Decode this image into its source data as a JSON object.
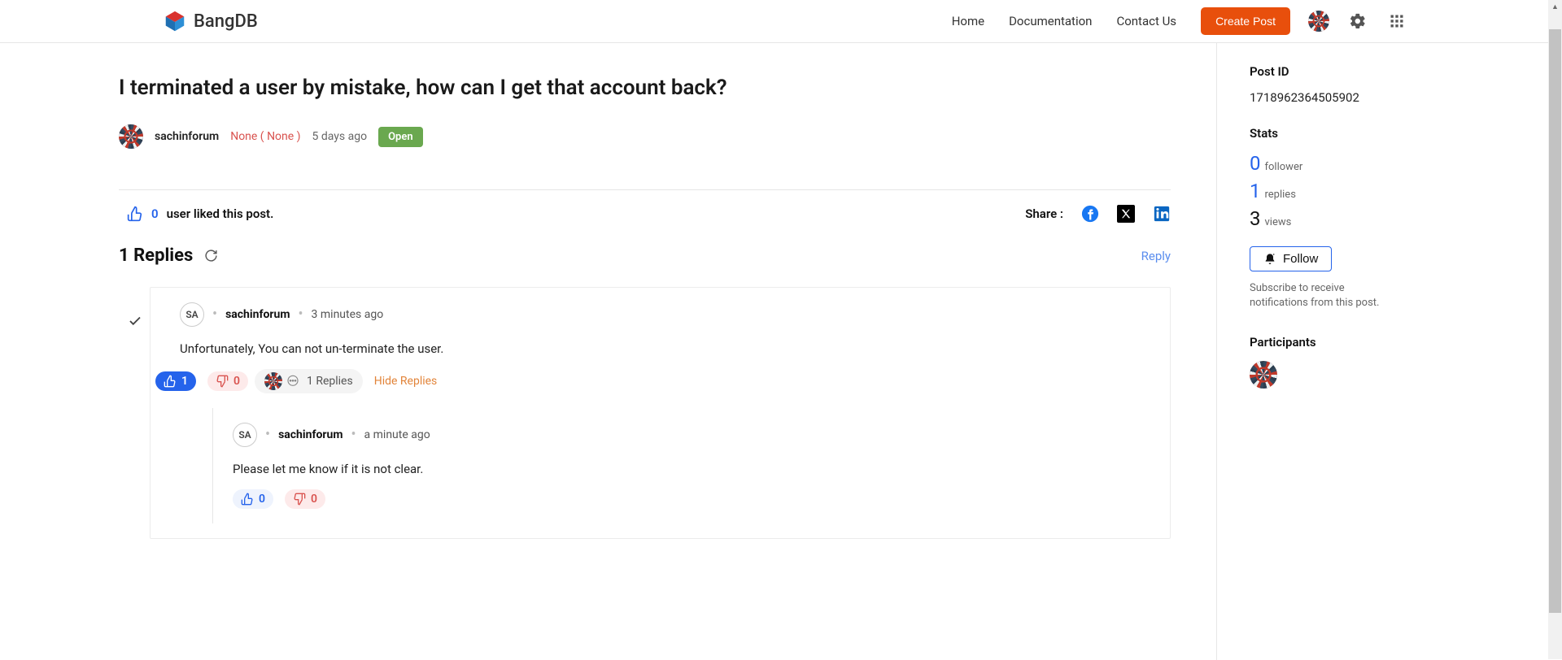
{
  "header": {
    "brand": "BangDB",
    "nav": {
      "home": "Home",
      "docs": "Documentation",
      "contact": "Contact Us"
    },
    "create_post": "Create Post"
  },
  "post": {
    "title": "I terminated a user by mistake, how can I get that account back?",
    "author": "sachinforum",
    "category": "None ( None )",
    "time": "5 days ago",
    "status": "Open"
  },
  "likes": {
    "count": "0",
    "text": "user liked this post."
  },
  "share": {
    "label": "Share :"
  },
  "replies_section": {
    "title": "1 Replies",
    "reply_link": "Reply"
  },
  "reply1": {
    "initials": "SA",
    "author": "sachinforum",
    "time": "3 minutes ago",
    "body": "Unfortunately, You can not un-terminate the user.",
    "like_count": "1",
    "dislike_count": "0",
    "nested_count_label": "1 Replies",
    "hide_label": "Hide Replies"
  },
  "reply1_nested": {
    "initials": "SA",
    "author": "sachinforum",
    "time": "a minute ago",
    "body": "Please let me know if it is not clear.",
    "like_count": "0",
    "dislike_count": "0"
  },
  "sidebar": {
    "postid_h": "Post ID",
    "postid": "1718962364505902",
    "stats_h": "Stats",
    "followers_n": "0",
    "followers_l": "follower",
    "replies_n": "1",
    "replies_l": "replies",
    "views_n": "3",
    "views_l": "views",
    "follow_btn": "Follow",
    "follow_sub": "Subscribe to receive notifications from this post.",
    "participants_h": "Participants"
  }
}
